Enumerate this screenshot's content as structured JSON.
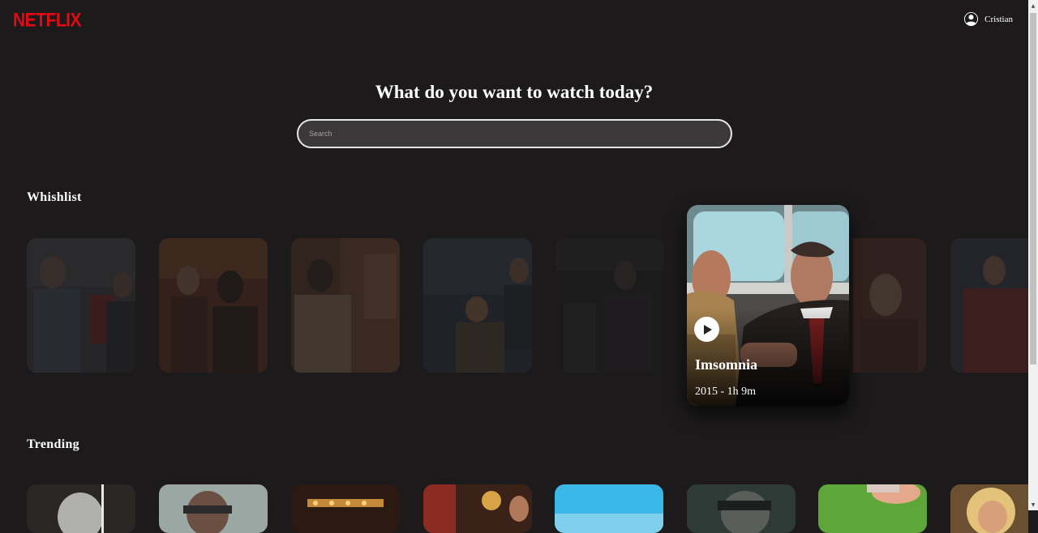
{
  "header": {
    "logo": "NETFLIX",
    "user": {
      "name": "Cristian",
      "icon": "user-circle-icon"
    }
  },
  "hero": {
    "headline": "What do you want to watch today?",
    "search_placeholder": "Search"
  },
  "wishlist": {
    "title": "Whishlist",
    "featured": {
      "title": "Imsomnia",
      "meta": "2015 - 1h 9m",
      "play_icon": "play-icon"
    }
  },
  "trending": {
    "title": "Trending"
  },
  "colors": {
    "background": "#1c1a1a",
    "brand": "#e50914",
    "text": "#ffffff"
  }
}
